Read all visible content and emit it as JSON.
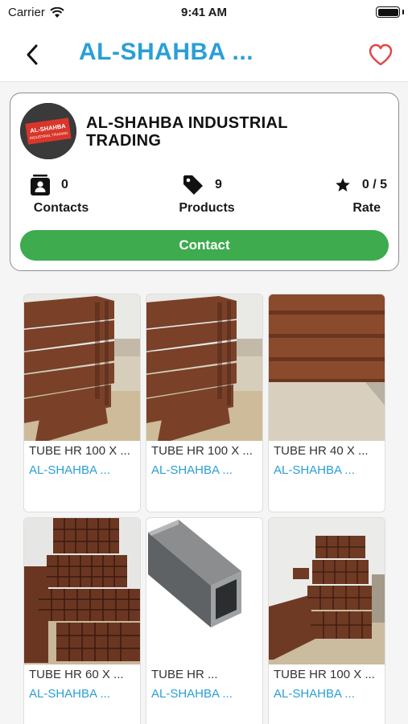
{
  "status_bar": {
    "carrier": "Carrier",
    "time": "9:41 AM"
  },
  "nav": {
    "title": "AL-SHAHBA ...",
    "accent_color": "#2a9fd6",
    "favorite_color": "#e04848"
  },
  "store": {
    "logo_text_line1": "AL-SHAHBA",
    "logo_text_line2": "INDUSTRIAL TRADING",
    "name": "AL-SHAHBA INDUSTRIAL TRADING",
    "stats": {
      "contacts": {
        "value": "0",
        "label": "Contacts",
        "icon": "contact-card-icon"
      },
      "products": {
        "value": "9",
        "label": "Products",
        "icon": "tag-icon"
      },
      "rate": {
        "value": "0 / 5",
        "label": "Rate",
        "icon": "star-icon"
      }
    },
    "contact_button": "Contact",
    "contact_button_color": "#3dab4e"
  },
  "products": [
    {
      "title": "TUBE HR 100 X ...",
      "store": "AL-SHAHBA ...",
      "image": "stacked-rectangular-tubes"
    },
    {
      "title": "TUBE HR 100 X ...",
      "store": "AL-SHAHBA ...",
      "image": "stacked-rectangular-tubes"
    },
    {
      "title": "TUBE HR 40 X ...",
      "store": "AL-SHAHBA ...",
      "image": "flat-tube-stack-closeup"
    },
    {
      "title": "TUBE HR 60 X ...",
      "store": "AL-SHAHBA ...",
      "image": "square-tube-stack-front"
    },
    {
      "title": "TUBE HR ...",
      "store": "AL-SHAHBA ...",
      "image": "single-square-tube"
    },
    {
      "title": "TUBE HR 100 X ...",
      "store": "AL-SHAHBA ...",
      "image": "square-tube-stacks-yard"
    }
  ]
}
